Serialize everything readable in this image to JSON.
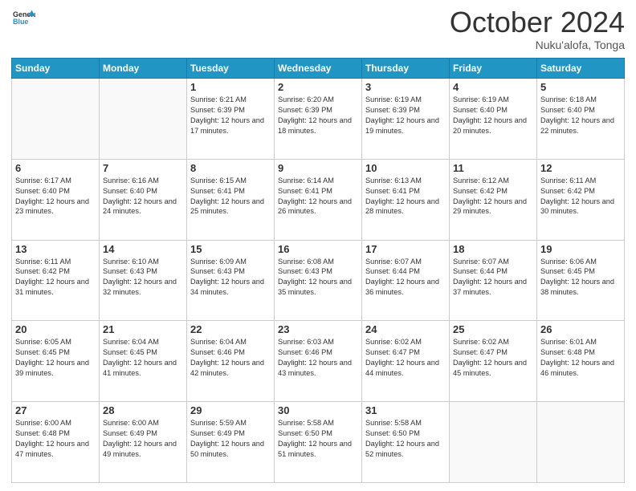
{
  "header": {
    "logo_line1": "General",
    "logo_line2": "Blue",
    "month": "October 2024",
    "location": "Nuku'alofa, Tonga"
  },
  "weekdays": [
    "Sunday",
    "Monday",
    "Tuesday",
    "Wednesday",
    "Thursday",
    "Friday",
    "Saturday"
  ],
  "weeks": [
    [
      {
        "day": "",
        "info": ""
      },
      {
        "day": "",
        "info": ""
      },
      {
        "day": "1",
        "info": "Sunrise: 6:21 AM\nSunset: 6:39 PM\nDaylight: 12 hours and 17 minutes."
      },
      {
        "day": "2",
        "info": "Sunrise: 6:20 AM\nSunset: 6:39 PM\nDaylight: 12 hours and 18 minutes."
      },
      {
        "day": "3",
        "info": "Sunrise: 6:19 AM\nSunset: 6:39 PM\nDaylight: 12 hours and 19 minutes."
      },
      {
        "day": "4",
        "info": "Sunrise: 6:19 AM\nSunset: 6:40 PM\nDaylight: 12 hours and 20 minutes."
      },
      {
        "day": "5",
        "info": "Sunrise: 6:18 AM\nSunset: 6:40 PM\nDaylight: 12 hours and 22 minutes."
      }
    ],
    [
      {
        "day": "6",
        "info": "Sunrise: 6:17 AM\nSunset: 6:40 PM\nDaylight: 12 hours and 23 minutes."
      },
      {
        "day": "7",
        "info": "Sunrise: 6:16 AM\nSunset: 6:40 PM\nDaylight: 12 hours and 24 minutes."
      },
      {
        "day": "8",
        "info": "Sunrise: 6:15 AM\nSunset: 6:41 PM\nDaylight: 12 hours and 25 minutes."
      },
      {
        "day": "9",
        "info": "Sunrise: 6:14 AM\nSunset: 6:41 PM\nDaylight: 12 hours and 26 minutes."
      },
      {
        "day": "10",
        "info": "Sunrise: 6:13 AM\nSunset: 6:41 PM\nDaylight: 12 hours and 28 minutes."
      },
      {
        "day": "11",
        "info": "Sunrise: 6:12 AM\nSunset: 6:42 PM\nDaylight: 12 hours and 29 minutes."
      },
      {
        "day": "12",
        "info": "Sunrise: 6:11 AM\nSunset: 6:42 PM\nDaylight: 12 hours and 30 minutes."
      }
    ],
    [
      {
        "day": "13",
        "info": "Sunrise: 6:11 AM\nSunset: 6:42 PM\nDaylight: 12 hours and 31 minutes."
      },
      {
        "day": "14",
        "info": "Sunrise: 6:10 AM\nSunset: 6:43 PM\nDaylight: 12 hours and 32 minutes."
      },
      {
        "day": "15",
        "info": "Sunrise: 6:09 AM\nSunset: 6:43 PM\nDaylight: 12 hours and 34 minutes."
      },
      {
        "day": "16",
        "info": "Sunrise: 6:08 AM\nSunset: 6:43 PM\nDaylight: 12 hours and 35 minutes."
      },
      {
        "day": "17",
        "info": "Sunrise: 6:07 AM\nSunset: 6:44 PM\nDaylight: 12 hours and 36 minutes."
      },
      {
        "day": "18",
        "info": "Sunrise: 6:07 AM\nSunset: 6:44 PM\nDaylight: 12 hours and 37 minutes."
      },
      {
        "day": "19",
        "info": "Sunrise: 6:06 AM\nSunset: 6:45 PM\nDaylight: 12 hours and 38 minutes."
      }
    ],
    [
      {
        "day": "20",
        "info": "Sunrise: 6:05 AM\nSunset: 6:45 PM\nDaylight: 12 hours and 39 minutes."
      },
      {
        "day": "21",
        "info": "Sunrise: 6:04 AM\nSunset: 6:45 PM\nDaylight: 12 hours and 41 minutes."
      },
      {
        "day": "22",
        "info": "Sunrise: 6:04 AM\nSunset: 6:46 PM\nDaylight: 12 hours and 42 minutes."
      },
      {
        "day": "23",
        "info": "Sunrise: 6:03 AM\nSunset: 6:46 PM\nDaylight: 12 hours and 43 minutes."
      },
      {
        "day": "24",
        "info": "Sunrise: 6:02 AM\nSunset: 6:47 PM\nDaylight: 12 hours and 44 minutes."
      },
      {
        "day": "25",
        "info": "Sunrise: 6:02 AM\nSunset: 6:47 PM\nDaylight: 12 hours and 45 minutes."
      },
      {
        "day": "26",
        "info": "Sunrise: 6:01 AM\nSunset: 6:48 PM\nDaylight: 12 hours and 46 minutes."
      }
    ],
    [
      {
        "day": "27",
        "info": "Sunrise: 6:00 AM\nSunset: 6:48 PM\nDaylight: 12 hours and 47 minutes."
      },
      {
        "day": "28",
        "info": "Sunrise: 6:00 AM\nSunset: 6:49 PM\nDaylight: 12 hours and 49 minutes."
      },
      {
        "day": "29",
        "info": "Sunrise: 5:59 AM\nSunset: 6:49 PM\nDaylight: 12 hours and 50 minutes."
      },
      {
        "day": "30",
        "info": "Sunrise: 5:58 AM\nSunset: 6:50 PM\nDaylight: 12 hours and 51 minutes."
      },
      {
        "day": "31",
        "info": "Sunrise: 5:58 AM\nSunset: 6:50 PM\nDaylight: 12 hours and 52 minutes."
      },
      {
        "day": "",
        "info": ""
      },
      {
        "day": "",
        "info": ""
      }
    ]
  ]
}
